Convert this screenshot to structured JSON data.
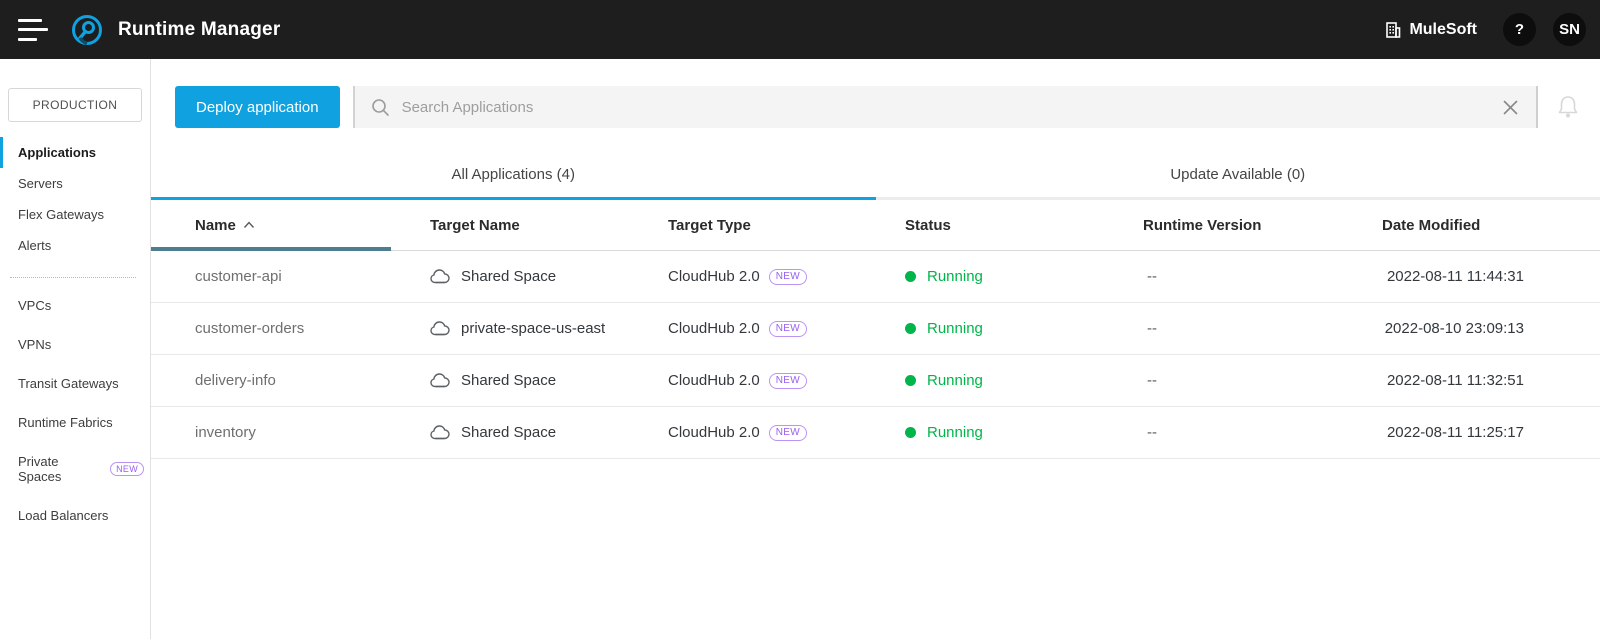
{
  "topbar": {
    "title": "Runtime Manager",
    "org_name": "MuleSoft",
    "help_label": "?",
    "avatar_initials": "SN"
  },
  "sidebar": {
    "environment": "PRODUCTION",
    "items": [
      {
        "label": "Applications",
        "active": true
      },
      {
        "label": "Servers"
      },
      {
        "label": "Flex Gateways"
      },
      {
        "label": "Alerts"
      },
      {
        "divider": true
      },
      {
        "label": "VPCs"
      },
      {
        "label": "VPNs"
      },
      {
        "label": "Transit Gateways"
      },
      {
        "label": "Runtime Fabrics"
      },
      {
        "label": "Private Spaces",
        "badge": "NEW"
      },
      {
        "label": "Load Balancers"
      }
    ]
  },
  "toolbar": {
    "deploy_label": "Deploy application",
    "search_placeholder": "Search Applications",
    "search_value": ""
  },
  "tabs": [
    {
      "label": "All Applications (4)",
      "active": true
    },
    {
      "label": "Update Available (0)",
      "active": false
    }
  ],
  "table": {
    "columns": [
      "Name",
      "Target Name",
      "Target Type",
      "Status",
      "Runtime Version",
      "Date Modified"
    ],
    "sorted_by": "Name",
    "sort_direction": "asc",
    "rows": [
      {
        "name": "customer-api",
        "target_name": "Shared Space",
        "target_type": "CloudHub 2.0",
        "type_badge": "NEW",
        "status": "Running",
        "runtime_version": "--",
        "date_modified": "2022-08-11 11:44:31"
      },
      {
        "name": "customer-orders",
        "target_name": "private-space-us-east",
        "target_type": "CloudHub 2.0",
        "type_badge": "NEW",
        "status": "Running",
        "runtime_version": "--",
        "date_modified": "2022-08-10 23:09:13"
      },
      {
        "name": "delivery-info",
        "target_name": "Shared Space",
        "target_type": "CloudHub 2.0",
        "type_badge": "NEW",
        "status": "Running",
        "runtime_version": "--",
        "date_modified": "2022-08-11 11:32:51"
      },
      {
        "name": "inventory",
        "target_name": "Shared Space",
        "target_type": "CloudHub 2.0",
        "type_badge": "NEW",
        "status": "Running",
        "runtime_version": "--",
        "date_modified": "2022-08-11 11:25:17"
      }
    ]
  },
  "icons": {
    "menu": "hamburger-icon",
    "logo": "runtime-manager-logo",
    "organization": "building-icon",
    "search": "magnifier-icon",
    "clear_search": "close-icon",
    "notifications": "bell-icon",
    "sort": "caret-up-icon",
    "target": "cloud-icon",
    "status": "status-dot"
  },
  "colors": {
    "accent_blue": "#0fa1e0",
    "status_green": "#00b54a",
    "badge_purple": "#9a5ff2",
    "sort_teal": "#4d7d8e",
    "topbar_bg": "#1f1e1e",
    "search_bg": "#f4f4f4"
  }
}
